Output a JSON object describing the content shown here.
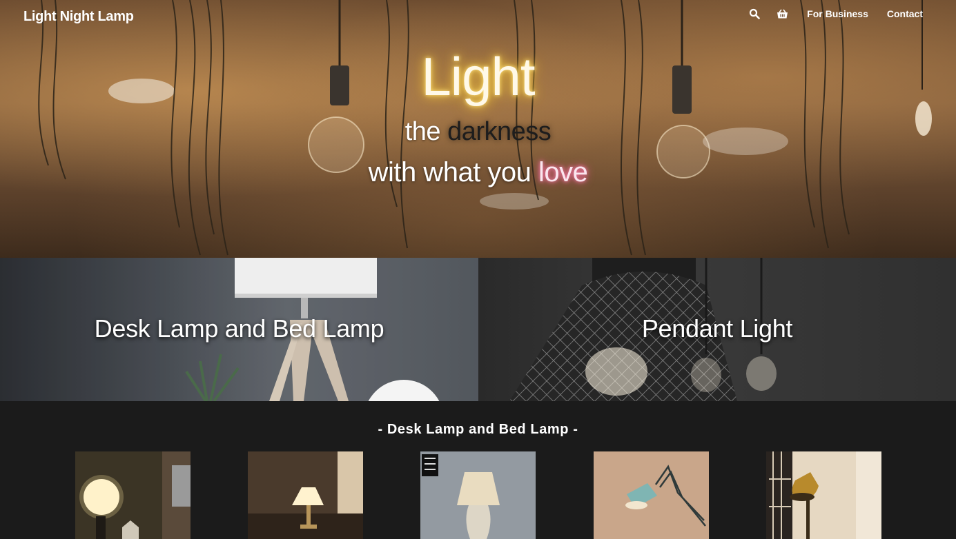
{
  "header": {
    "brand": "Light Night Lamp",
    "nav": [
      {
        "icon": "search-icon"
      },
      {
        "icon": "basket-icon"
      },
      {
        "label": "For Business"
      },
      {
        "label": "Contact"
      }
    ]
  },
  "hero": {
    "line1": "Light",
    "line2_a": "the ",
    "line2_b": "darkness",
    "line3_a": "with what you ",
    "line3_b": "love"
  },
  "categories": [
    {
      "title": "Desk Lamp and Bed Lamp"
    },
    {
      "title": "Pendant Light"
    }
  ],
  "products_section": {
    "title": "- Desk Lamp and Bed Lamp -"
  },
  "colors": {
    "page_bg": "#1b1b1b",
    "light_glow": "#f2c94c",
    "love_glow": "#ff5a9a"
  }
}
